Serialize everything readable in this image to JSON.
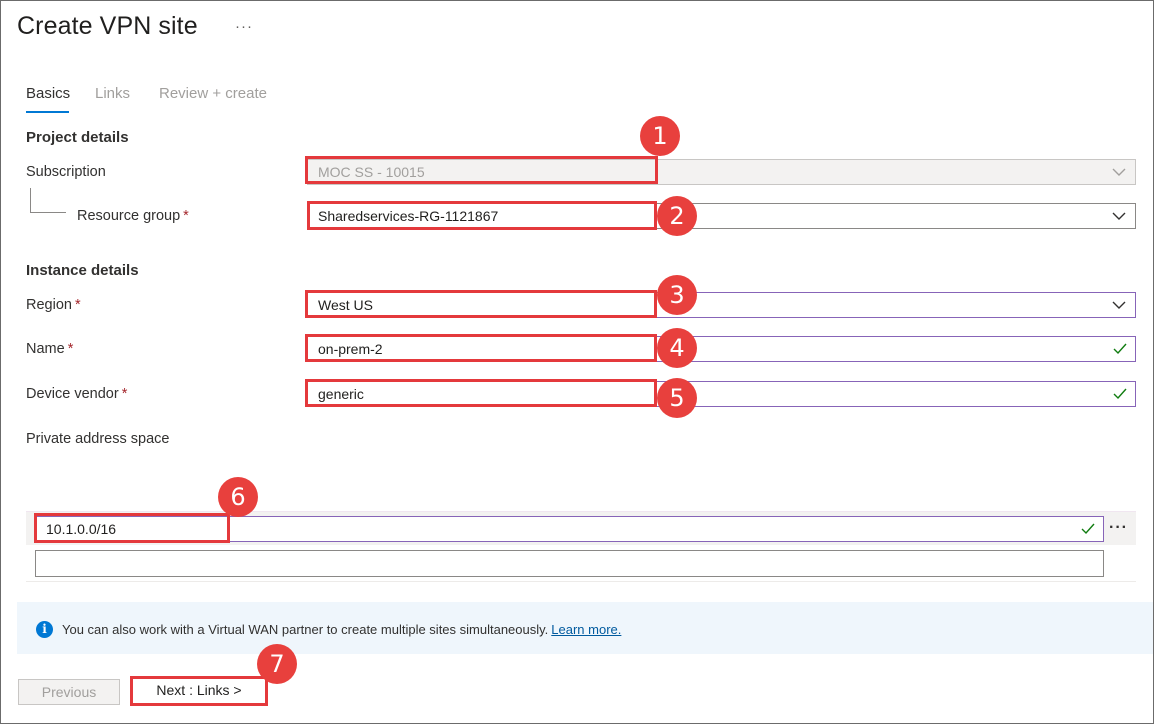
{
  "header": {
    "title": "Create VPN site",
    "more_label": "···"
  },
  "tabs": [
    {
      "label": "Basics",
      "active": true
    },
    {
      "label": "Links",
      "active": false
    },
    {
      "label": "Review + create",
      "active": false
    }
  ],
  "project_details": {
    "heading": "Project details",
    "subscription": {
      "label": "Subscription",
      "value": "MOC SS - 10015",
      "disabled": true
    },
    "resource_group": {
      "label": "Resource group",
      "required_mark": "*",
      "value": "Sharedservices-RG-1121867"
    }
  },
  "instance_details": {
    "heading": "Instance details",
    "region": {
      "label": "Region",
      "required_mark": "*",
      "value": "West US"
    },
    "name": {
      "label": "Name",
      "required_mark": "*",
      "value": "on-prem-2"
    },
    "device_vendor": {
      "label": "Device vendor",
      "required_mark": "*",
      "value": "generic"
    },
    "private_address_space": {
      "label": "Private address space",
      "entries": [
        "10.1.0.0/16",
        ""
      ],
      "more_label": "···"
    }
  },
  "info_bar": {
    "icon": "info-icon",
    "icon_glyph": "i",
    "text": "You can also work with a Virtual WAN partner to create multiple sites simultaneously.",
    "link_text": "Learn more."
  },
  "footer": {
    "previous_label": "Previous",
    "next_label": "Next : Links >"
  },
  "annotations": [
    "1",
    "2",
    "3",
    "4",
    "5",
    "6",
    "7"
  ],
  "colors": {
    "annotation_red": "#e8403d",
    "accent_blue": "#0078d4",
    "valid_green": "#107c10"
  }
}
